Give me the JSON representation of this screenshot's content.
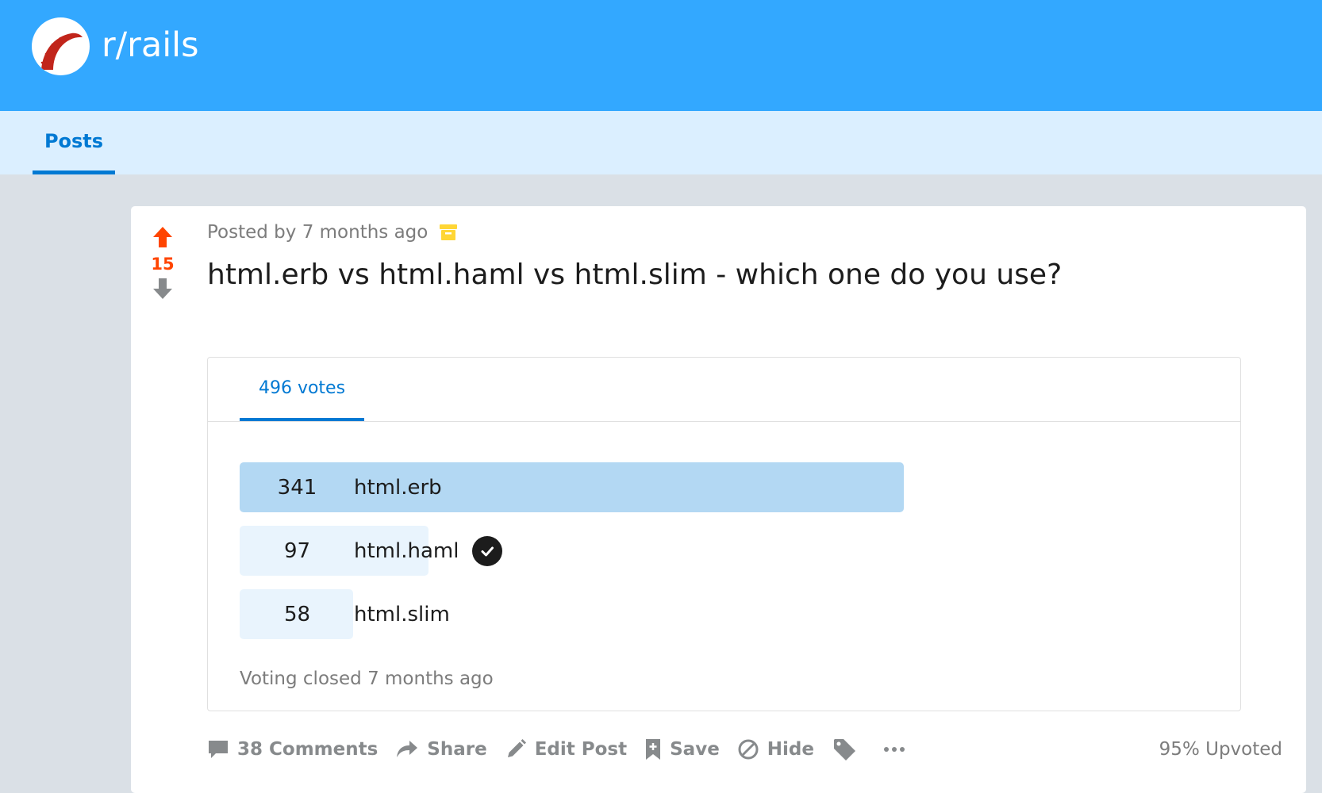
{
  "header": {
    "subreddit": "r/rails"
  },
  "tabs": [
    {
      "label": "Posts"
    }
  ],
  "post": {
    "score": "15",
    "meta": "Posted by 7 months ago",
    "title": "html.erb vs html.haml vs html.slim - which one do you use?",
    "poll": {
      "tab_label": "496 votes",
      "total_votes": 496,
      "options": [
        {
          "count": "341",
          "label": "html.erb",
          "votes": 341,
          "selected": false
        },
        {
          "count": "97",
          "label": "html.haml",
          "votes": 97,
          "selected": true
        },
        {
          "count": "58",
          "label": "html.slim",
          "votes": 58,
          "selected": false
        }
      ],
      "status": "Voting closed 7 months ago"
    },
    "actions": {
      "comments": "38 Comments",
      "share": "Share",
      "edit": "Edit Post",
      "save": "Save",
      "hide": "Hide"
    },
    "upvoted": "95% Upvoted"
  },
  "colors": {
    "banner": "#33a8ff",
    "upvote": "#ff4500",
    "accent": "#0079d3",
    "poll_bar_leading": "#b3d8f3",
    "poll_bar": "#e9f4fd"
  },
  "icons": {
    "logo": "rails-logo",
    "archive": "archive-icon",
    "upvote": "upvote-arrow-icon",
    "downvote": "downvote-arrow-icon"
  }
}
